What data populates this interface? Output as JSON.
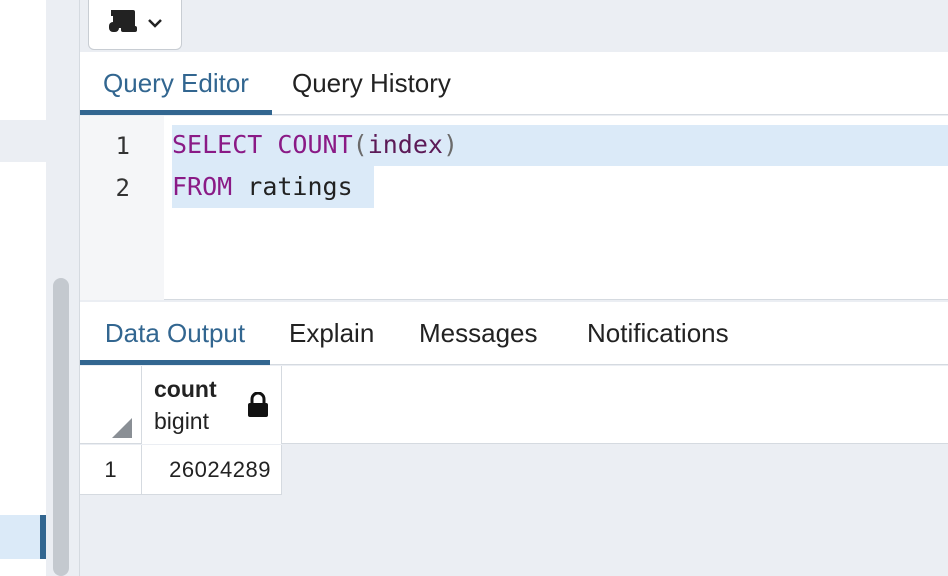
{
  "toolbar": {
    "icon": "scroll-icon",
    "dropdown_icon": "chevron-down-icon"
  },
  "editor_tabs": [
    {
      "label": "Query Editor",
      "active": true
    },
    {
      "label": "Query History",
      "active": false
    }
  ],
  "editor": {
    "lines": [
      {
        "number": "1",
        "tokens": {
          "kw1": "SELECT",
          "fn": "COUNT",
          "open": "(",
          "arg": "index",
          "close": ")"
        }
      },
      {
        "number": "2",
        "tokens": {
          "kw": "FROM",
          "table": "ratings"
        }
      }
    ]
  },
  "result_tabs": [
    {
      "label": "Data Output",
      "active": true
    },
    {
      "label": "Explain",
      "active": false
    },
    {
      "label": "Messages",
      "active": false
    },
    {
      "label": "Notifications",
      "active": false
    }
  ],
  "grid": {
    "columns": [
      {
        "name": "count",
        "type": "bigint",
        "icon": "lock-icon"
      }
    ],
    "rows": [
      {
        "row_number": "1",
        "values": [
          "26024289"
        ]
      }
    ]
  },
  "colors": {
    "accent": "#326690",
    "keyword": "#8a1a86",
    "selection": "#dbeaf8"
  }
}
